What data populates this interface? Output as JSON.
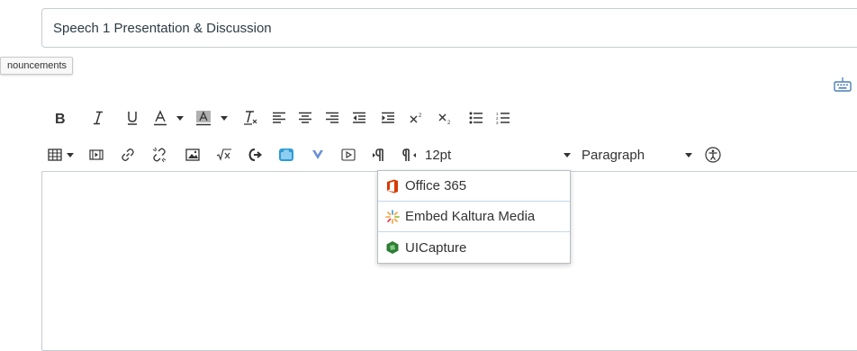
{
  "title_field": {
    "value": "Speech 1 Presentation & Discussion"
  },
  "tooltip": {
    "text": "nouncements"
  },
  "keyboard_shortcut": {
    "icon": "keyboard-icon"
  },
  "toolbar_row1": [
    {
      "name": "bold-button",
      "icon": "bold-icon",
      "glyph": "B"
    },
    {
      "name": "italic-button",
      "icon": "italic-icon",
      "glyph": "I"
    },
    {
      "name": "underline-button",
      "icon": "underline-icon",
      "glyph": "U"
    },
    {
      "name": "text-color-button",
      "icon": "text-color-icon",
      "glyph": "A"
    },
    {
      "name": "background-color-button",
      "icon": "background-color-icon",
      "glyph": "A"
    },
    {
      "name": "clear-formatting-button",
      "icon": "clear-formatting-icon",
      "glyph": "T"
    },
    {
      "name": "align-left-button",
      "icon": "align-left-icon"
    },
    {
      "name": "align-center-button",
      "icon": "align-center-icon"
    },
    {
      "name": "align-right-button",
      "icon": "align-right-icon"
    },
    {
      "name": "outdent-button",
      "icon": "outdent-icon"
    },
    {
      "name": "indent-button",
      "icon": "indent-icon"
    },
    {
      "name": "superscript-button",
      "icon": "superscript-icon"
    },
    {
      "name": "subscript-button",
      "icon": "subscript-icon"
    },
    {
      "name": "bullet-list-button",
      "icon": "bullet-list-icon"
    },
    {
      "name": "numbered-list-button",
      "icon": "numbered-list-icon"
    }
  ],
  "toolbar_row2": {
    "font_size": "12pt",
    "block_format": "Paragraph",
    "icons": [
      "table-icon",
      "media-icon",
      "link-icon",
      "unlink-icon",
      "image-icon",
      "equation-icon",
      "lti-icon",
      "apps-icon",
      "v-icon",
      "embed-icon",
      "ltr-icon",
      "rtl-icon",
      "accessibility-icon"
    ]
  },
  "dropdown": {
    "items": [
      {
        "label": "Office 365",
        "icon": "office365-icon",
        "color": "#d83b01"
      },
      {
        "label": "Embed Kaltura Media",
        "icon": "kaltura-icon",
        "color": "#f2a33a"
      },
      {
        "label": "UICapture",
        "icon": "uicapture-icon",
        "color": "#2e7d32"
      }
    ]
  },
  "colors": {
    "border": "#c7cdd1",
    "text": "#2d3b45",
    "apps_blue": "#2d9bd7",
    "v_blue": "#6a8fd6"
  }
}
